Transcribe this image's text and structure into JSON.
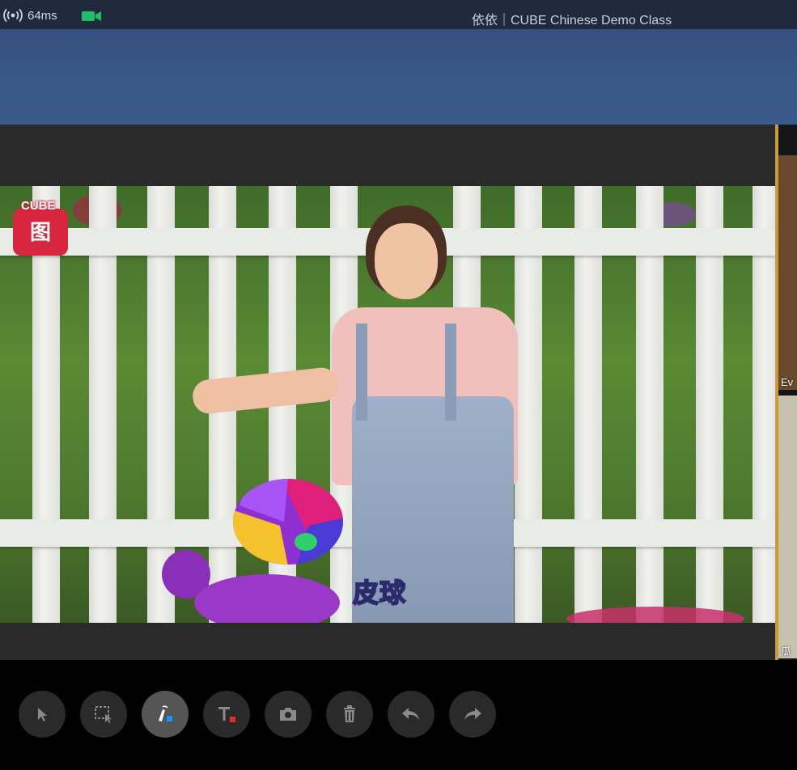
{
  "topbar": {
    "latency": "64ms",
    "title": "依依｜CUBE Chinese Demo Class",
    "icons": [
      "broadcast-signal-icon",
      "camera-icon"
    ],
    "camera_color": "#1fbf6a"
  },
  "video": {
    "logo_text": "CUBE",
    "logo_glyph": "图",
    "caption": "皮球"
  },
  "participants": [
    {
      "name_fragment": "Ev"
    },
    {
      "name_fragment": "瓜"
    }
  ],
  "toolbar": {
    "tools": [
      {
        "id": "select",
        "icon": "cursor-arrow-icon",
        "active": false
      },
      {
        "id": "marquee",
        "icon": "marquee-select-icon",
        "active": false
      },
      {
        "id": "pen",
        "icon": "pen-icon",
        "active": true
      },
      {
        "id": "text",
        "icon": "text-tool-icon",
        "active": false
      },
      {
        "id": "screenshot",
        "icon": "camera-icon",
        "active": false
      },
      {
        "id": "delete",
        "icon": "trash-icon",
        "active": false
      },
      {
        "id": "undo",
        "icon": "undo-icon",
        "active": false
      },
      {
        "id": "redo",
        "icon": "redo-icon",
        "active": false
      }
    ],
    "accent_colors": {
      "pen": "#1e90ff",
      "text": "#e52b2b"
    }
  }
}
